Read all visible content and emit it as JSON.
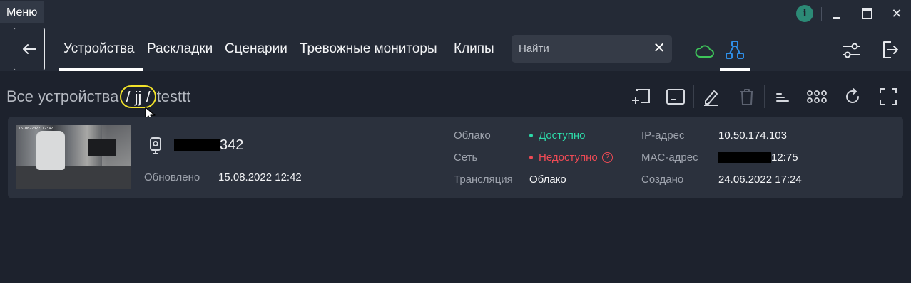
{
  "window": {
    "menu_label": "Меню",
    "info_label": "i"
  },
  "nav": {
    "tabs": [
      {
        "label": "Устройства",
        "active": true
      },
      {
        "label": "Раскладки",
        "active": false
      },
      {
        "label": "Сценарии",
        "active": false
      },
      {
        "label": "Тревожные мониторы",
        "active": false
      },
      {
        "label": "Клипы",
        "active": false
      }
    ],
    "search_placeholder": "Найти",
    "accent_cloud": "#3ec45a",
    "accent_network": "#2f8fe8"
  },
  "breadcrumb": {
    "root": "Все устройства",
    "folder": "/ jj /",
    "current": "testtt"
  },
  "toolbar_icons": [
    "add-device-icon",
    "add-folder-icon",
    "edit-icon",
    "delete-icon",
    "list-view-icon",
    "grid-view-icon",
    "refresh-icon",
    "fullscreen-icon"
  ],
  "device": {
    "name_suffix": "342",
    "updated_label": "Обновлено",
    "updated_value": "15.08.2022 12:42",
    "thumb_stamp": "15-08-2022 12:42",
    "cloud_label": "Облако",
    "cloud_value": "Доступно",
    "network_label": "Сеть",
    "network_value": "Недоступно",
    "stream_label": "Трансляция",
    "stream_value": "Облако",
    "ip_label": "IP-адрес",
    "ip_value": "10.50.174.103",
    "mac_label": "MAC-адрес",
    "mac_suffix": "12:75",
    "created_label": "Создано",
    "created_value": "24.06.2022 17:24"
  },
  "colors": {
    "background": "#1d222d",
    "topbar": "#242a36",
    "card": "#2b313d",
    "ok": "#2dd9a8",
    "error": "#ef4a55",
    "highlight": "#f2e22a"
  }
}
